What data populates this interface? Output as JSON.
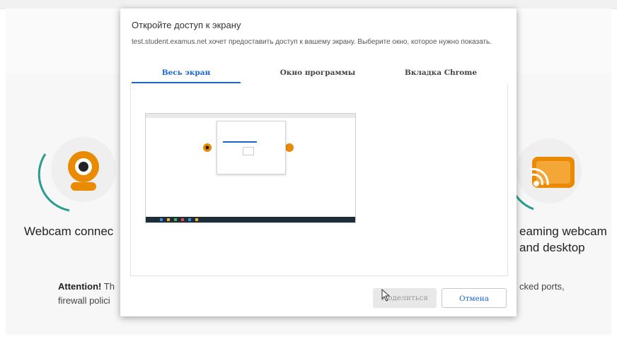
{
  "background": {
    "webcam_label": "Webcam connec",
    "streaming_label_line1": "eaming webcam",
    "streaming_label_line2": "and desktop",
    "attention_bold": "Attention!",
    "attention_rest": " Th",
    "attention_line2": "firewall polici",
    "right_fragment": "cked ports,",
    "accent_color": "#e98a00",
    "arc_color": "#2a9d8f"
  },
  "dialog": {
    "title": "Откройте доступ к экрану",
    "description": "test.student.examus.net хочет предоставить доступ к вашему экрану. Выберите окно, которое нужно показать.",
    "tabs": [
      {
        "label": "Весь экран",
        "active": true
      },
      {
        "label": "Окно программы",
        "active": false
      },
      {
        "label": "Вкладка Chrome",
        "active": false
      }
    ],
    "share_button": "Поделиться",
    "cancel_button": "Отмена",
    "accent_color": "#1a66c9"
  }
}
